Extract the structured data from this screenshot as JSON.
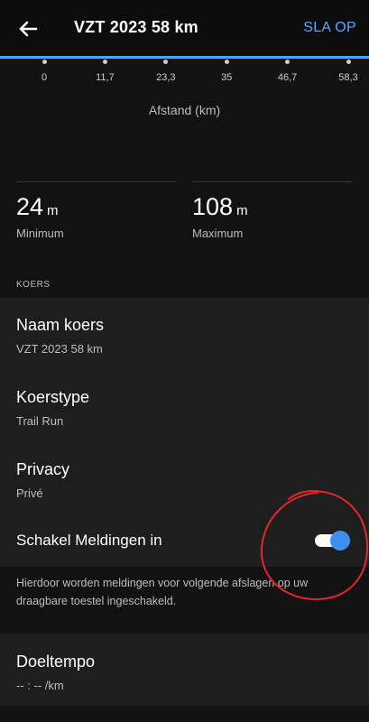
{
  "header": {
    "back_icon": "arrow-left-icon",
    "title": "VZT 2023 58 km",
    "save_label": "SLA OP",
    "accent_color": "#4da3ff"
  },
  "chart_data": {
    "type": "line",
    "x_ticks": [
      "0",
      "11,7",
      "23,3",
      "35",
      "46,7",
      "58,3"
    ],
    "xlabel": "Afstand (km)"
  },
  "elevation": {
    "minimum": {
      "value": "24",
      "unit": "m",
      "label": "Minimum"
    },
    "maximum": {
      "value": "108",
      "unit": "m",
      "label": "Maximum"
    }
  },
  "course": {
    "section_title": "KOERS",
    "name": {
      "label": "Naam koers",
      "value": "VZT 2023 58 km"
    },
    "type": {
      "label": "Koerstype",
      "value": "Trail Run"
    },
    "privacy": {
      "label": "Privacy",
      "value": "Privé"
    },
    "notifications": {
      "label": "Schakel Meldingen in",
      "enabled": true,
      "description": "Hierdoor worden meldingen voor volgende afslagen op uw draagbare toestel ingeschakeld."
    },
    "target_pace": {
      "label": "Doeltempo",
      "value": "-- : --  /km"
    }
  },
  "annotation": {
    "color": "#e0282b"
  }
}
